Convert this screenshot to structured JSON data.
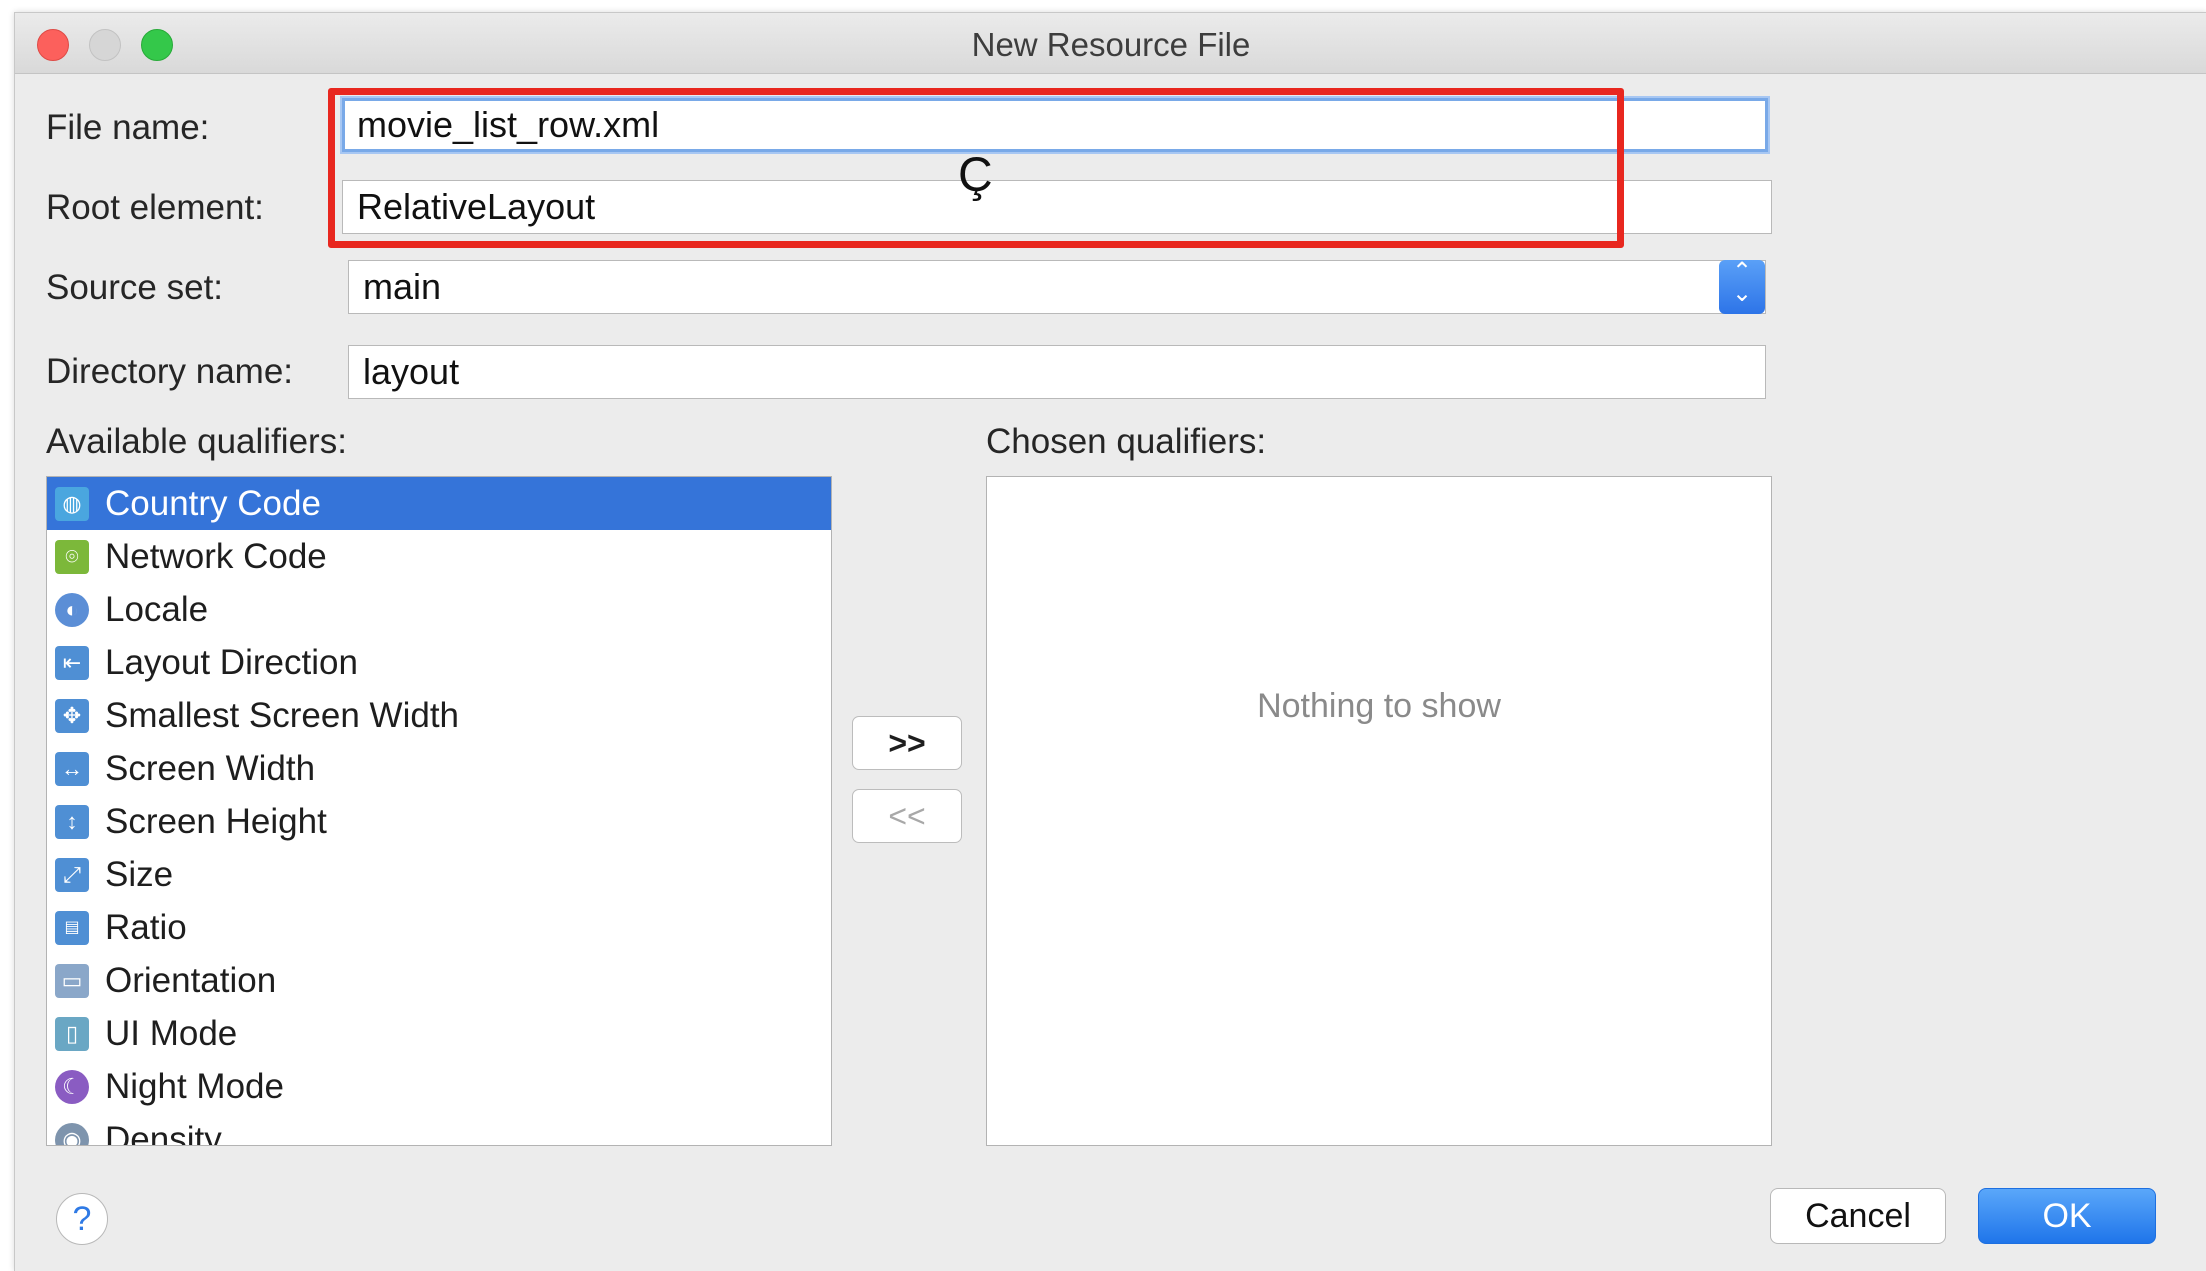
{
  "window": {
    "title": "New Resource File"
  },
  "form": {
    "file_name_label": "File name:",
    "file_name_value": "movie_list_row.xml",
    "root_element_label": "Root element:",
    "root_element_value": "RelativeLayout",
    "source_set_label": "Source set:",
    "source_set_value": "main",
    "directory_name_label": "Directory name:",
    "directory_name_value": "layout"
  },
  "cursor_glyph": "Ç",
  "qualifiers": {
    "available_label": "Available qualifiers:",
    "chosen_label": "Chosen qualifiers:",
    "available": [
      {
        "label": "Country Code",
        "icon": "globe-code-icon",
        "selected": true
      },
      {
        "label": "Network Code",
        "icon": "network-icon"
      },
      {
        "label": "Locale",
        "icon": "globe-icon"
      },
      {
        "label": "Layout Direction",
        "icon": "layout-direction-icon"
      },
      {
        "label": "Smallest Screen Width",
        "icon": "resize-all-icon"
      },
      {
        "label": "Screen Width",
        "icon": "width-icon"
      },
      {
        "label": "Screen Height",
        "icon": "height-icon"
      },
      {
        "label": "Size",
        "icon": "size-icon"
      },
      {
        "label": "Ratio",
        "icon": "ratio-icon"
      },
      {
        "label": "Orientation",
        "icon": "orientation-icon"
      },
      {
        "label": "UI Mode",
        "icon": "device-icon"
      },
      {
        "label": "Night Mode",
        "icon": "moon-icon"
      },
      {
        "label": "Density",
        "icon": "density-icon"
      }
    ],
    "chosen_empty": "Nothing to show",
    "add_button": ">>",
    "remove_button": "<<"
  },
  "buttons": {
    "help": "?",
    "cancel": "Cancel",
    "ok": "OK"
  },
  "colors": {
    "selection": "#3574d9",
    "accent": "#2f7ae5",
    "highlight": "#e8271f"
  }
}
